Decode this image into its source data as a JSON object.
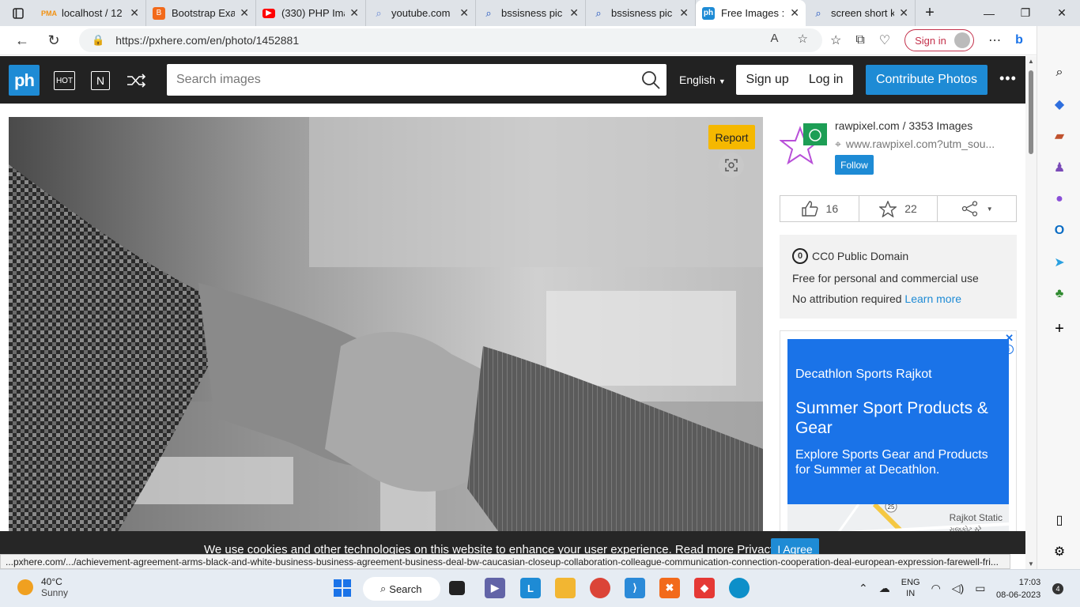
{
  "browser": {
    "tabs": [
      {
        "title": "localhost / 12",
        "favicon": "phpmyadmin-icon",
        "color": "#f29111"
      },
      {
        "title": "Bootstrap Exa",
        "favicon": "bootstrap-icon",
        "color": "#f26a1b"
      },
      {
        "title": "(330) PHP Ima",
        "favicon": "youtube-icon",
        "color": "#ff0000"
      },
      {
        "title": "youtube.com",
        "favicon": "search-icon",
        "color": "#6b8bd6"
      },
      {
        "title": "bssisness pic",
        "favicon": "search-icon",
        "color": "#1a4fbd"
      },
      {
        "title": "bssisness pic",
        "favicon": "search-icon",
        "color": "#1a4fbd"
      },
      {
        "title": "Free Images :",
        "favicon": "pxhere-icon",
        "color": "#1e8bd5",
        "active": true
      },
      {
        "title": "screen short k",
        "favicon": "search-icon",
        "color": "#1a4fbd"
      }
    ],
    "url": "https://pxhere.com/en/photo/1452881",
    "signin_label": "Sign in",
    "status_url": "...pxhere.com/.../achievement-agreement-arms-black-and-white-business-business-agreement-business-deal-bw-caucasian-closeup-collaboration-colleague-communication-connection-cooperation-deal-european-expression-farewell-fri..."
  },
  "site": {
    "logo": "ph",
    "hot_label": "HOT",
    "new_label": "N",
    "search_placeholder": "Search images",
    "language": "English",
    "signup": "Sign up",
    "login": "Log in",
    "contribute": "Contribute Photos",
    "accent": "#1e8bd5"
  },
  "photo": {
    "report_label": "Report"
  },
  "author": {
    "name": "rawpixel.com / 3353 Images",
    "site": "www.rawpixel.com?utm_sou...",
    "follow": "Follow"
  },
  "stats": {
    "likes": "16",
    "favorites": "22"
  },
  "license": {
    "cc_symbol": "0",
    "title": "CC0 Public Domain",
    "line1": "Free for personal and commercial use",
    "line2": "No attribution required",
    "learn_more": "Learn more"
  },
  "ad": {
    "brand": "Decathlon Sports Rajkot",
    "title": "Summer Sport Products & Gear",
    "desc": "Explore Sports Gear and Products for Summer at Decathlon.",
    "map_label": "Rajkot Static",
    "map_sub": "રાજકોટ સ્ટે",
    "road_no": "25"
  },
  "cookie": {
    "text": "We use cookies and other technologies on this website to enhance your user experience. Read more Privacy Policy.",
    "agree": "I Agree"
  },
  "taskbar": {
    "temp": "40°C",
    "weather": "Sunny",
    "search": "Search",
    "lang1": "ENG",
    "lang2": "IN",
    "time": "17:03",
    "date": "08-06-2023",
    "notifications": "4"
  }
}
